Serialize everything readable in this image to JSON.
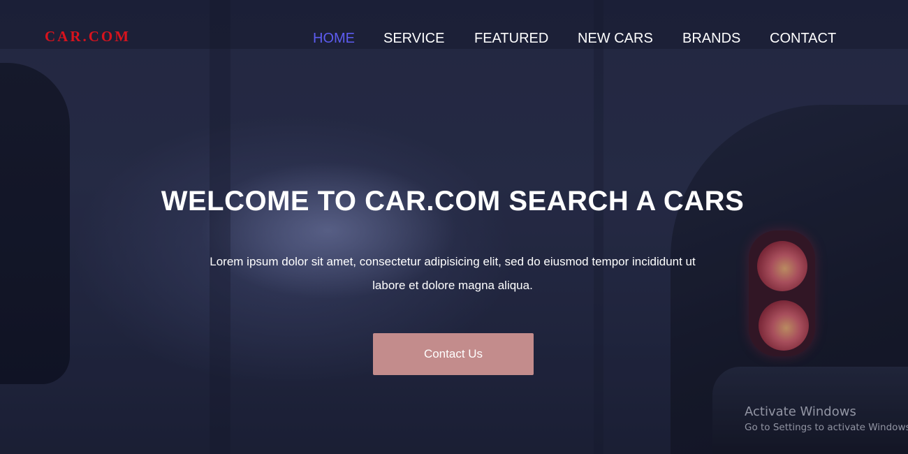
{
  "brand": {
    "logo_text": "CAR.COM",
    "logo_color": "#d8131d"
  },
  "nav": {
    "items": [
      {
        "label": "HOME",
        "active": true
      },
      {
        "label": "SERVICE",
        "active": false
      },
      {
        "label": "FEATURED",
        "active": false
      },
      {
        "label": "NEW CARS",
        "active": false
      },
      {
        "label": "BRANDS",
        "active": false
      },
      {
        "label": "CONTACT",
        "active": false
      }
    ],
    "active_color": "#5d5cf0"
  },
  "hero": {
    "headline": "WELCOME TO CAR.COM SEARCH A CARS",
    "lead": "Lorem ipsum dolor sit amet, consectetur adipisicing elit, sed do eiusmod tempor incididunt ut labore et dolore magna aliqua.",
    "cta_label": "Contact Us",
    "cta_color": "#c38c8c"
  },
  "watermark": {
    "title": "Activate Windows",
    "subtitle": "Go to Settings to activate Windows."
  }
}
